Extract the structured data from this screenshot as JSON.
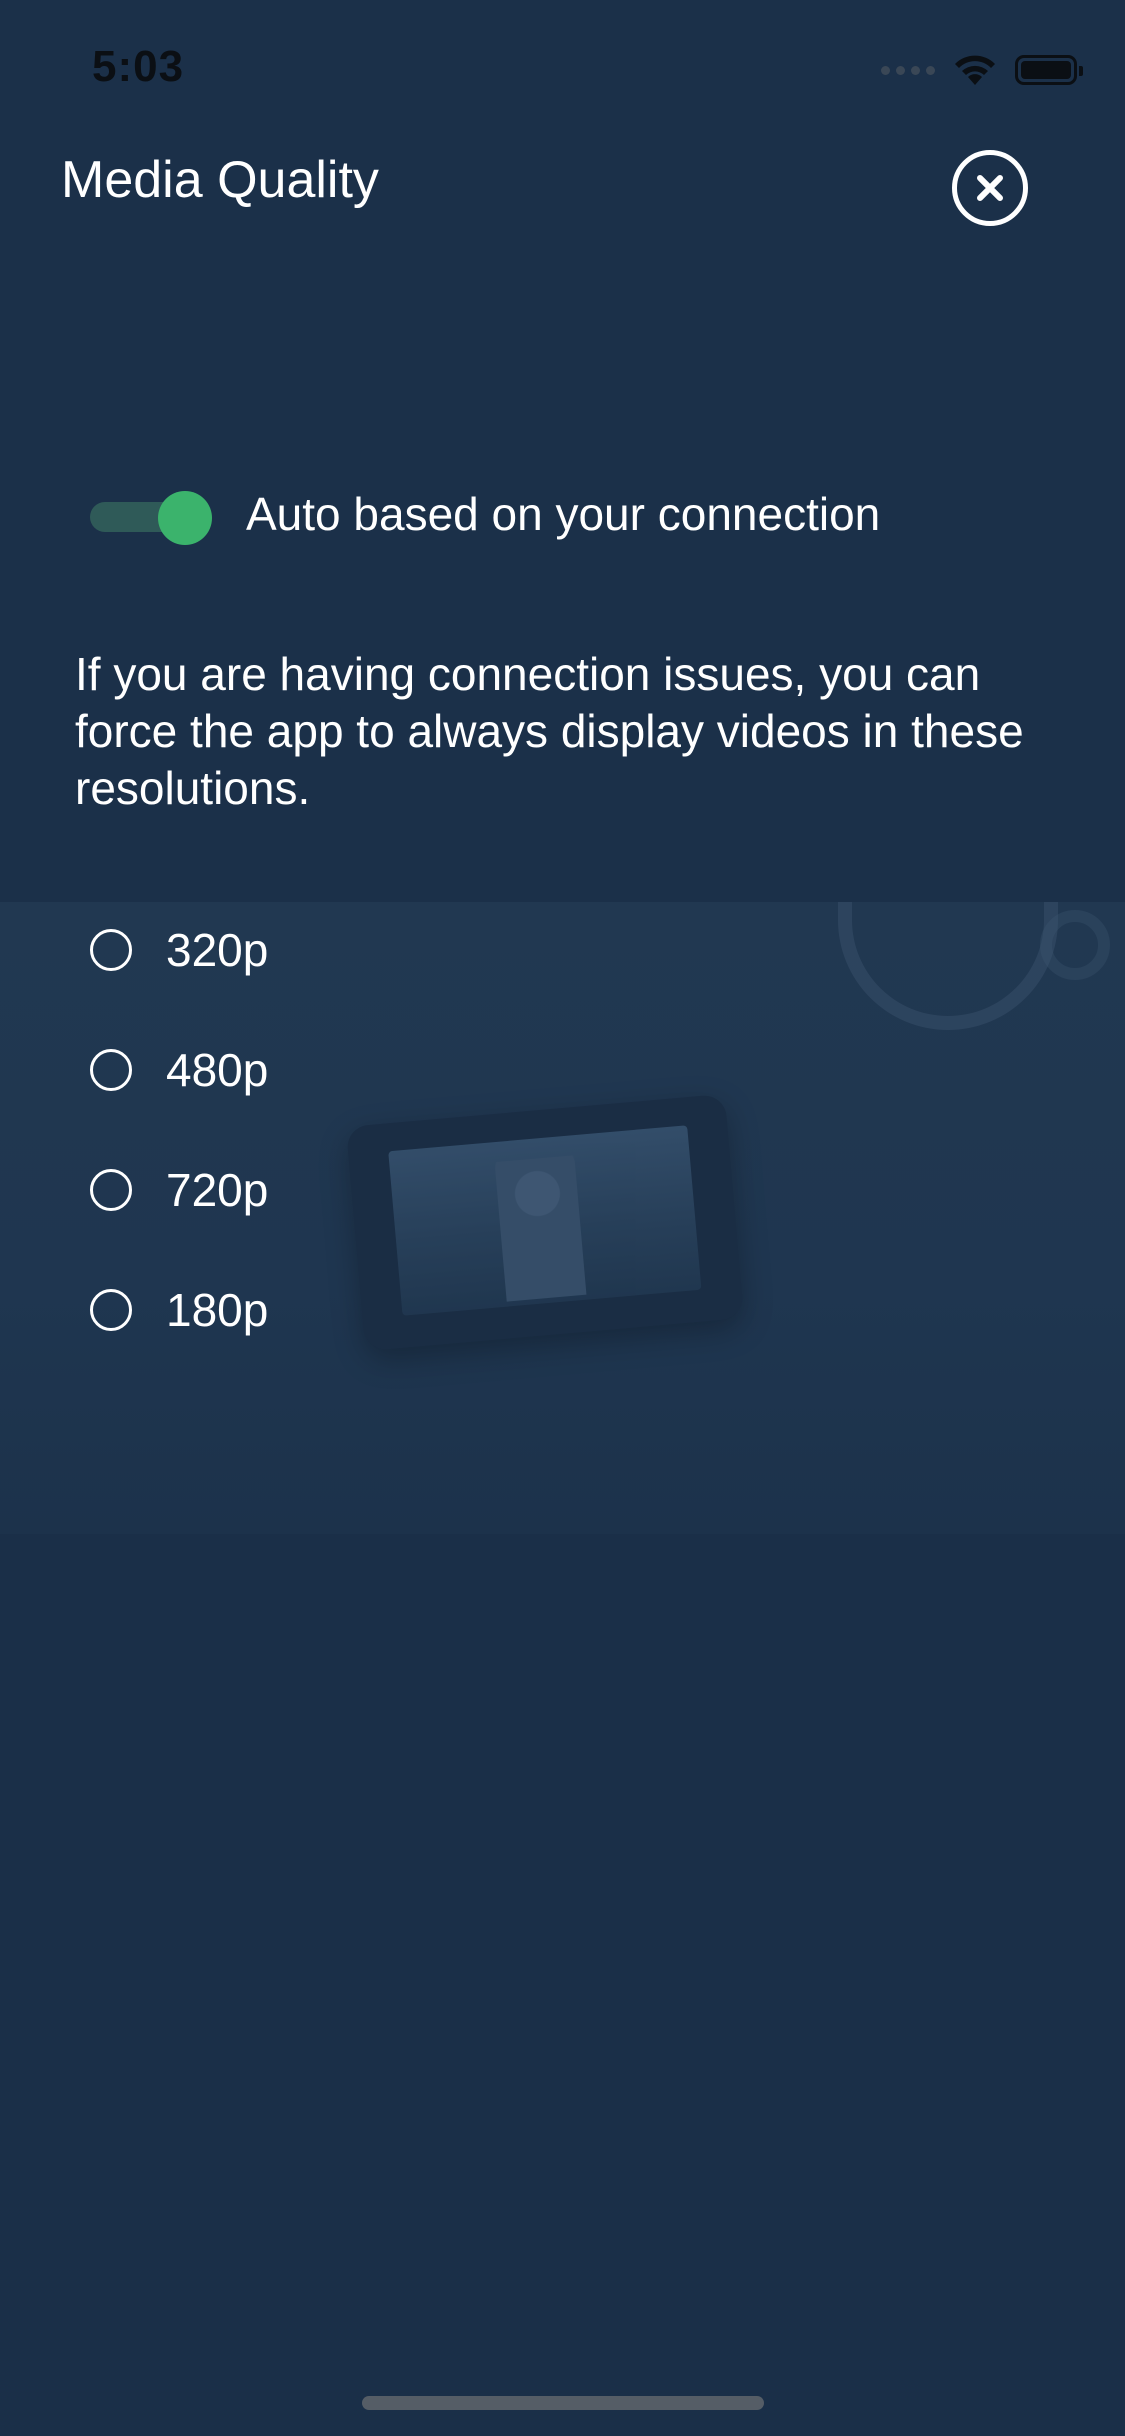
{
  "status_bar": {
    "time": "5:03"
  },
  "header": {
    "title": "Media Quality",
    "close_icon": "close-circle-icon"
  },
  "auto_quality": {
    "label": "Auto based on your connection",
    "enabled": true,
    "toggle_color": "#3bb36c"
  },
  "description": "If you are having connection issues, you can force the app to always display videos in these resolutions.",
  "resolutions": [
    {
      "label": "320p",
      "selected": false
    },
    {
      "label": "480p",
      "selected": false
    },
    {
      "label": "720p",
      "selected": false
    },
    {
      "label": "180p",
      "selected": false
    }
  ],
  "colors": {
    "background": "#1a2f48",
    "accent": "#3bb36c",
    "text": "#ffffff"
  }
}
